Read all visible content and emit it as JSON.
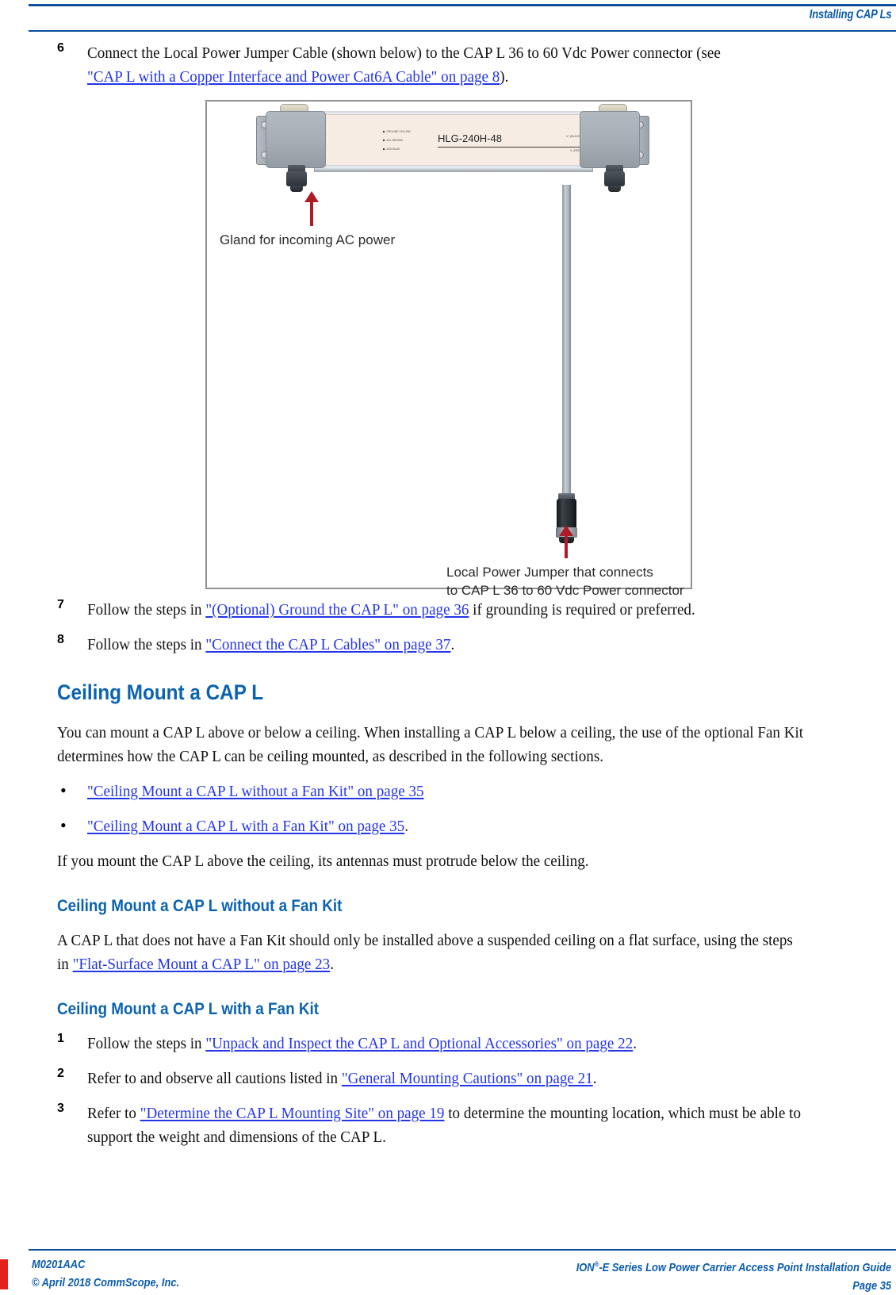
{
  "header": {
    "running_title": "Installing CAP Ls"
  },
  "steps_top": [
    {
      "num": "6",
      "line1_pre": "Connect the Local Power Jumper Cable (shown below) to the CAP L 36 to 60 Vdc Power connector (see",
      "line2_link": "\"CAP L with a Copper Interface and Power Cat6A Cable\" on page 8",
      "line2_post": ")."
    }
  ],
  "figure": {
    "device_model": "HLG-240H-48",
    "input_wire_labels": [
      "GROUND YELLOW",
      "ACL BROWN",
      "ACN BLUE"
    ],
    "output_wire_labels": [
      "V+ (BLACK)",
      "V- (RED)"
    ],
    "callout_gland": "Gland for incoming AC power",
    "callout_jumper_line1": "Local Power Jumper that connects",
    "callout_jumper_line2": "to CAP L 36 to 60 Vdc Power connector"
  },
  "steps_after_figure": [
    {
      "num": "7",
      "pre": "Follow the steps in ",
      "link": "\"(Optional) Ground the CAP L\" on page 36",
      "post": " if grounding is required or preferred."
    },
    {
      "num": "8",
      "pre": "Follow the steps in ",
      "link": "\"Connect the CAP L Cables\" on page 37",
      "post": "."
    }
  ],
  "section": {
    "h1": "Ceiling Mount a CAP L",
    "intro": "You can mount a CAP L above or below a ceiling. When installing a CAP L below a ceiling, the use of the optional Fan Kit determines how the CAP L can be ceiling mounted, as described in the following sections.",
    "bullets": [
      {
        "link": "\"Ceiling Mount a CAP L without a Fan Kit\" on page 35",
        "post": ""
      },
      {
        "link": "\"Ceiling Mount a CAP L with a Fan Kit\" on page 35",
        "post": "."
      }
    ],
    "note": "If you mount the CAP L above the ceiling, its antennas must protrude below the ceiling."
  },
  "subsection_without_fan": {
    "h2": "Ceiling Mount a CAP L without a Fan Kit",
    "pre": "A CAP L that does not have a Fan Kit should only be installed above a suspended ceiling on a flat surface, using the steps in ",
    "link": "\"Flat-Surface Mount a CAP L\" on page 23",
    "post": "."
  },
  "subsection_with_fan": {
    "h2": "Ceiling Mount a CAP L with a Fan Kit",
    "steps": [
      {
        "num": "1",
        "pre": "Follow the steps in ",
        "link": "\"Unpack and Inspect the CAP L and Optional Accessories\" on page 22",
        "post": "."
      },
      {
        "num": "2",
        "pre": "Refer to and observe all cautions listed in ",
        "link": "\"General Mounting Cautions\" on page 21",
        "post": "."
      },
      {
        "num": "3",
        "pre": "Refer to ",
        "link": "\"Determine the CAP L Mounting Site\" on page 19",
        "post": " to determine the mounting location, which must be able to support the weight and dimensions of the CAP L."
      }
    ]
  },
  "footer": {
    "doc_number": "M0201AAC",
    "copyright": "© April 2018 CommScope, Inc.",
    "guide_title_pre": "ION",
    "guide_title_sup": "®",
    "guide_title_post": "-E Series Low Power Carrier Access Point Installation Guide",
    "page_label": "Page 35"
  },
  "colors": {
    "brand_blue": "#0b5cab",
    "rule_blue": "#0b4f9e",
    "link_blue": "#2435e8",
    "heading_blue": "#0b63b0",
    "accent_red": "#e2231a",
    "arrow_red": "#b01b2a"
  }
}
